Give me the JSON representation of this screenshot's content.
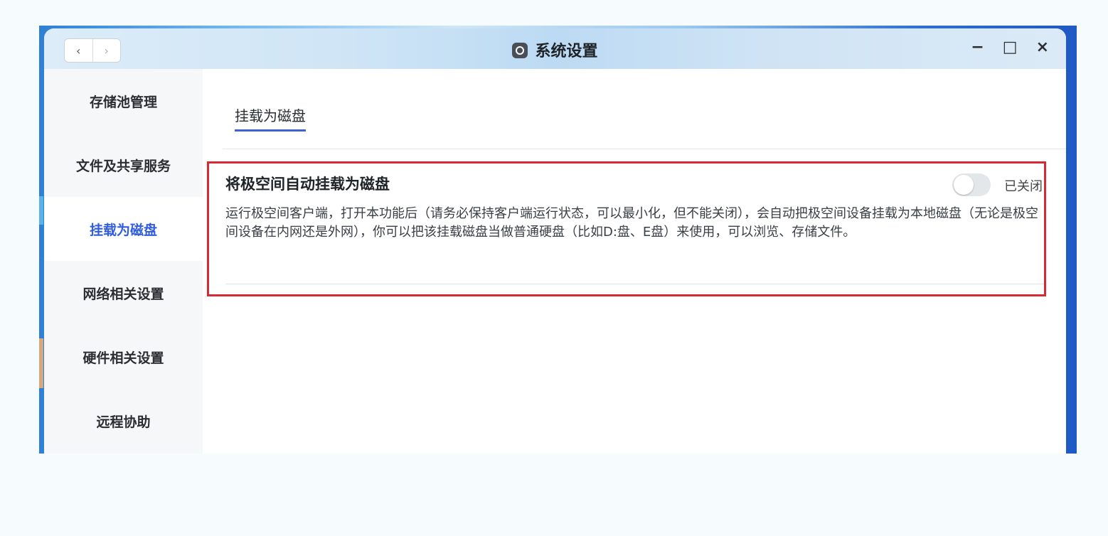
{
  "window": {
    "title": "系统设置",
    "back_glyph": "‹",
    "forward_glyph": "›",
    "controls": {
      "minimize": "−",
      "maximize": "□",
      "close": "×"
    }
  },
  "sidebar": {
    "items": [
      {
        "label": "存储池管理",
        "active": false
      },
      {
        "label": "文件及共享服务",
        "active": false
      },
      {
        "label": "挂载为磁盘",
        "active": true
      },
      {
        "label": "网络相关设置",
        "active": false
      },
      {
        "label": "硬件相关设置",
        "active": false
      },
      {
        "label": "远程协助",
        "active": false
      }
    ]
  },
  "main": {
    "tab_label": "挂载为磁盘",
    "setting": {
      "title": "将极空间自动挂载为磁盘",
      "toggle_state": "已关闭",
      "toggle_on": false,
      "description": "运行极空间客户端，打开本功能后（请务必保持客户端运行状态，可以最小化，但不能关闭），会自动把极空间设备挂载为本地磁盘（无论是极空间设备在内网还是外网），你可以把该挂载磁盘当做普通硬盘（比如D:盘、E盘）来使用，可以浏览、存储文件。"
    }
  },
  "colors": {
    "accent": "#2f5ce0",
    "highlight_border": "#d62b35",
    "toggle_off": "#e4e7ea"
  }
}
